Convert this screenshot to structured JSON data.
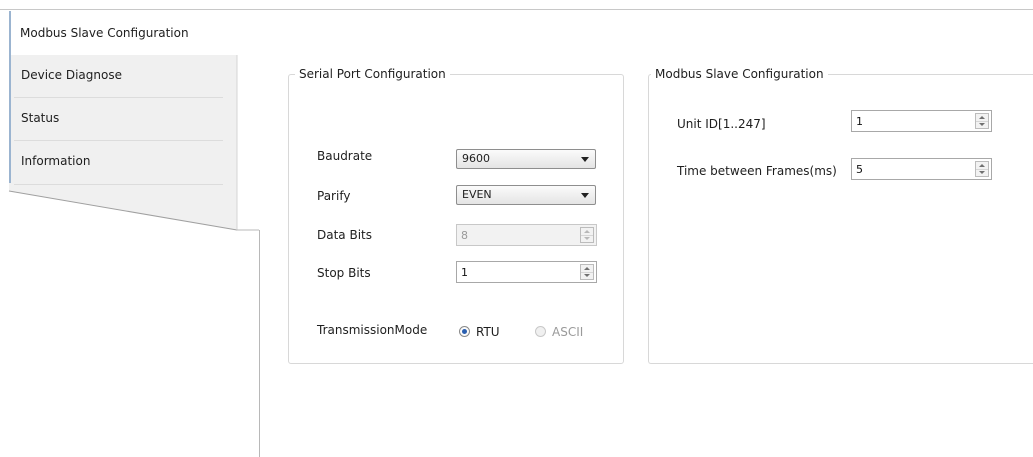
{
  "nav": {
    "items": [
      {
        "label": "Modbus Slave Configuration"
      },
      {
        "label": "Device Diagnose"
      },
      {
        "label": "Status"
      },
      {
        "label": "Information"
      }
    ]
  },
  "serial": {
    "title": "Serial Port Configuration",
    "baudrate_label": "Baudrate",
    "baudrate_value": "9600",
    "parity_label": "Parify",
    "parity_value": "EVEN",
    "databits_label": "Data Bits",
    "databits_value": "8",
    "stopbits_label": "Stop Bits",
    "stopbits_value": "1",
    "mode_label": "TransmissionMode",
    "mode_rtu": "RTU",
    "mode_ascii": "ASCII"
  },
  "slave": {
    "title": "Modbus Slave Configuration",
    "unitid_label": "Unit ID[1..247]",
    "unitid_value": "1",
    "frames_label": "Time between Frames(ms)",
    "frames_value": "5"
  },
  "colors": {
    "nav_bg": "#f0f0f0",
    "accent": "#9bb4d0",
    "radio_selected": "#2a5fb0"
  }
}
